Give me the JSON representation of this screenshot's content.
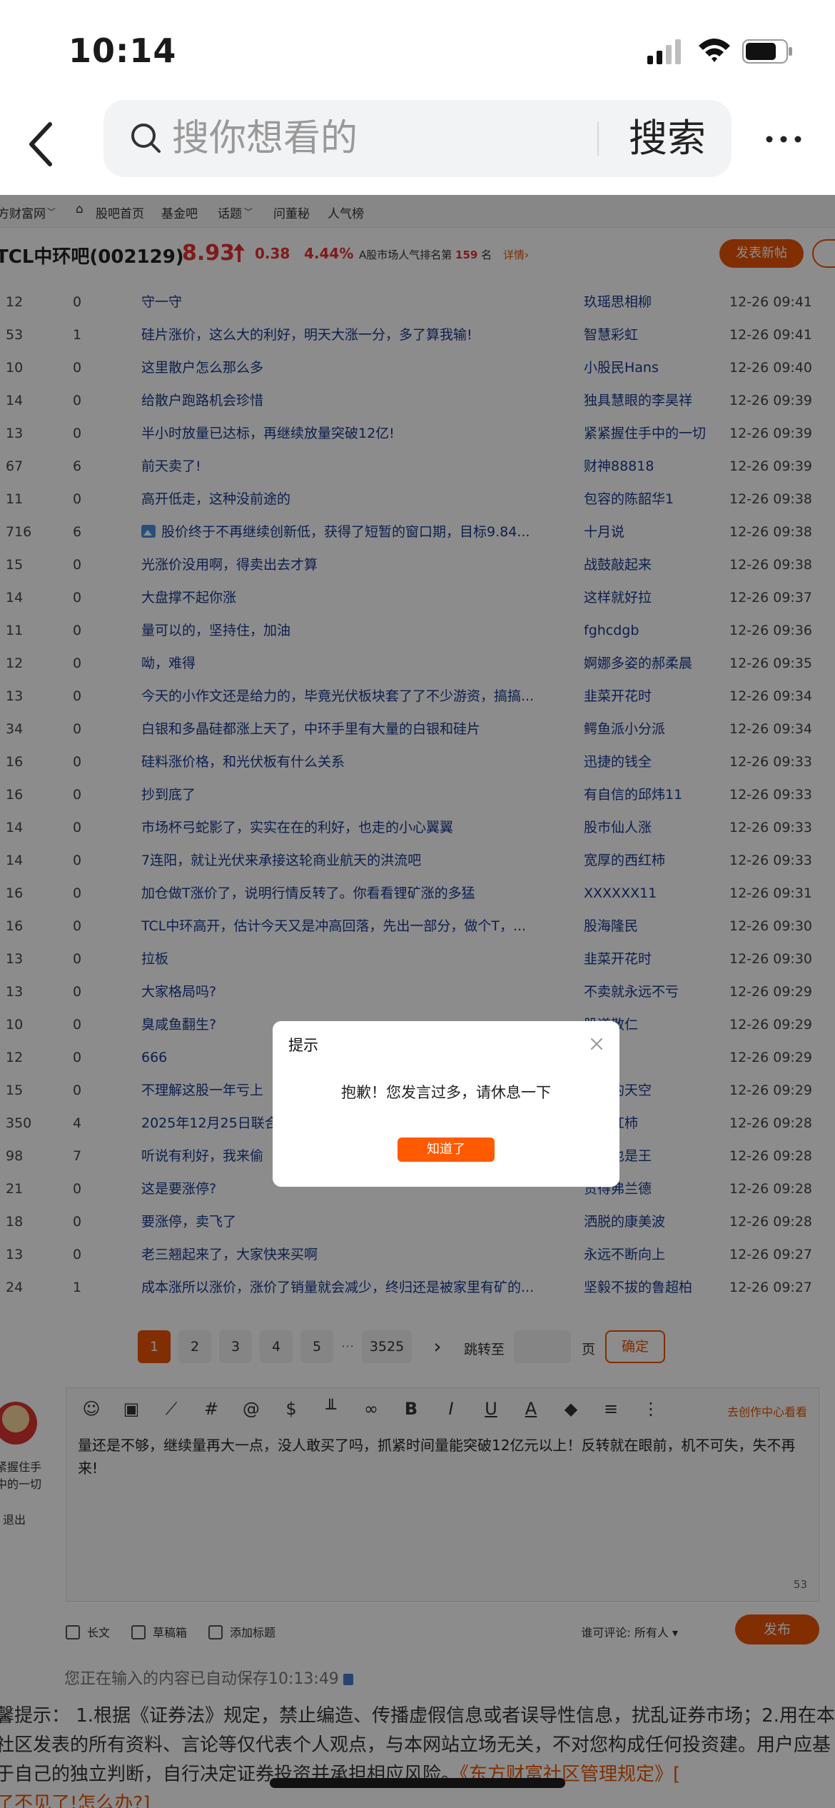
{
  "status": {
    "time": "10:14"
  },
  "search": {
    "placeholder": "搜你想看的",
    "button": "搜索"
  },
  "topnav": {
    "items": [
      "方财富网",
      "股吧首页",
      "基金吧",
      "话题",
      "问董秘",
      "人气榜"
    ]
  },
  "stock": {
    "name": "TCL中环吧(002129)",
    "price": "8.93",
    "change": "0.38",
    "change_pct": "4.44%",
    "rank_prefix": "A股市场人气排名第",
    "rank": "159",
    "rank_suffix": "名",
    "detail": "详情",
    "post_button": "发表新帖",
    "accent": "#e93030",
    "brand": "#ea5504"
  },
  "posts": [
    {
      "reads": "12",
      "comments": "0",
      "title": "守一守",
      "author": "玖瑶思相柳",
      "time": "12-26 09:41"
    },
    {
      "reads": "53",
      "comments": "1",
      "title": "硅片涨价，这么大的利好，明天大涨一分，多了算我输!",
      "author": "智慧彩虹",
      "time": "12-26 09:41"
    },
    {
      "reads": "10",
      "comments": "0",
      "title": "这里散户怎么那么多",
      "author": "小股民Hans",
      "time": "12-26 09:40"
    },
    {
      "reads": "14",
      "comments": "0",
      "title": "给散户跑路机会珍惜",
      "author": "独具慧眼的李昊祥",
      "time": "12-26 09:39"
    },
    {
      "reads": "13",
      "comments": "0",
      "title": "半小时放量已达标，再继续放量突破12亿!",
      "author": "紧紧握住手中的一切",
      "time": "12-26 09:39"
    },
    {
      "reads": "67",
      "comments": "6",
      "title": "前天卖了!",
      "author": "财神88818",
      "time": "12-26 09:39"
    },
    {
      "reads": "11",
      "comments": "0",
      "title": "高开低走，这种没前途的",
      "author": "包容的陈韶华1",
      "time": "12-26 09:38"
    },
    {
      "reads": "716",
      "comments": "6",
      "title": "股价终于不再继续创新低，获得了短暂的窗口期，目标9.84...",
      "author": "十月说",
      "time": "12-26 09:38",
      "image": true
    },
    {
      "reads": "15",
      "comments": "0",
      "title": "光涨价没用啊，得卖出去才算",
      "author": "战鼓敲起来",
      "time": "12-26 09:38"
    },
    {
      "reads": "14",
      "comments": "0",
      "title": "大盘撑不起你涨",
      "author": "这样就好拉",
      "time": "12-26 09:37"
    },
    {
      "reads": "11",
      "comments": "0",
      "title": "量可以的，坚持住，加油",
      "author": "fghcdgb",
      "time": "12-26 09:36"
    },
    {
      "reads": "12",
      "comments": "0",
      "title": "呦，难得",
      "author": "婀娜多姿的郝柔晨",
      "time": "12-26 09:35"
    },
    {
      "reads": "13",
      "comments": "0",
      "title": "今天的小作文还是给力的，毕竟光伏板块套了了不少游资，搞搞...",
      "author": "韭菜开花时",
      "time": "12-26 09:34"
    },
    {
      "reads": "34",
      "comments": "0",
      "title": "白银和多晶硅都涨上天了，中环手里有大量的白银和硅片",
      "author": "鳄鱼派小分派",
      "time": "12-26 09:34"
    },
    {
      "reads": "16",
      "comments": "0",
      "title": "硅料涨价格，和光伏板有什么关系",
      "author": "迅捷的钱全",
      "time": "12-26 09:33"
    },
    {
      "reads": "16",
      "comments": "0",
      "title": "抄到底了",
      "author": "有自信的邱炜11",
      "time": "12-26 09:33"
    },
    {
      "reads": "14",
      "comments": "0",
      "title": "市场杯弓蛇影了，实实在在的利好，也走的小心翼翼",
      "author": "股市仙人涨",
      "time": "12-26 09:33"
    },
    {
      "reads": "14",
      "comments": "0",
      "title": "7连阳，就让光伏来承接这轮商业航天的洪流吧",
      "author": "宽厚的西红柿",
      "time": "12-26 09:33"
    },
    {
      "reads": "16",
      "comments": "0",
      "title": "加仓做T涨价了，说明行情反转了。你看看锂矿涨的多猛",
      "author": "XXXXXX11",
      "time": "12-26 09:31"
    },
    {
      "reads": "16",
      "comments": "0",
      "title": "TCL中环高开，估计今天又是冲高回落，先出一部分，做个T，...",
      "author": "股海隆民",
      "time": "12-26 09:30"
    },
    {
      "reads": "13",
      "comments": "0",
      "title": "拉板",
      "author": "韭菜开花时",
      "time": "12-26 09:30"
    },
    {
      "reads": "13",
      "comments": "0",
      "title": "大家格局吗?",
      "author": "不卖就永远不亏",
      "time": "12-26 09:29"
    },
    {
      "reads": "10",
      "comments": "0",
      "title": "臭咸鱼翻生?",
      "author": "股道散仁",
      "time": "12-26 09:29"
    },
    {
      "reads": "12",
      "comments": "0",
      "title": "666",
      "author": "马跑9",
      "time": "12-26 09:29"
    },
    {
      "reads": "15",
      "comments": "0",
      "title": "不理解这股一年亏上",
      "author": "逆转的天空",
      "time": "12-26 09:29"
    },
    {
      "reads": "350",
      "comments": "4",
      "title": "2025年12月25日联合",
      "author": "的西红柿",
      "time": "12-26 09:28"
    },
    {
      "reads": "98",
      "comments": "7",
      "title": "听说有利好，我来偷",
      "author": "老王也是王",
      "time": "12-26 09:28"
    },
    {
      "reads": "21",
      "comments": "0",
      "title": "这是要涨停?",
      "author": "贯得弗兰德",
      "time": "12-26 09:28"
    },
    {
      "reads": "18",
      "comments": "0",
      "title": "要涨停，卖飞了",
      "author": "洒脱的康美波",
      "time": "12-26 09:28"
    },
    {
      "reads": "13",
      "comments": "0",
      "title": "老三翘起来了，大家快来买啊",
      "author": "永远不断向上",
      "time": "12-26 09:27"
    },
    {
      "reads": "24",
      "comments": "1",
      "title": "成本涨所以涨价，涨价了销量就会减少，终归还是被家里有矿的...",
      "author": "坚毅不拔的鲁超柏",
      "time": "12-26 09:27"
    }
  ],
  "pager": {
    "pages": [
      "1",
      "2",
      "3",
      "4",
      "5"
    ],
    "ellipsis": "···",
    "last": "3525",
    "next": "›",
    "jump_label": "跳转至",
    "page_label": "页",
    "confirm": "确定"
  },
  "editor": {
    "user_name": "紧握住手中的一切",
    "logout": "退出",
    "creation_center": "去创作中心看看",
    "content": "量还是不够，继续量再大一点，没人敢买了吗，抓紧时间量能突破12亿元以上！反转就在眼前，机不可失，失不再来!",
    "char_count": "53",
    "long_text": "长文",
    "drafts": "草稿箱",
    "add_title": "添加标题",
    "who_comment": "谁可评论: 所有人",
    "publish": "发布",
    "autosave": "您正在输入的内容已自动保存10:13:49"
  },
  "disclaimer": {
    "text": "馨提示： 1.根据《证券法》规定，禁止编造、传播虚假信息或者误导性信息，扰乱证券市场；2.用在本社区发表的所有资料、言论等仅代表个人观点，与本网站立场无关，不对您构成任何投资建。用户应基于自己的独立判断，自行决定证券投资并承担相应风险。",
    "link": "《东方财富社区管理规定》[",
    "tail": "了不见了!怎么办?]"
  },
  "modal": {
    "title": "提示",
    "message": "抱歉！您发言过多，请休息一下",
    "ok": "知道了"
  }
}
